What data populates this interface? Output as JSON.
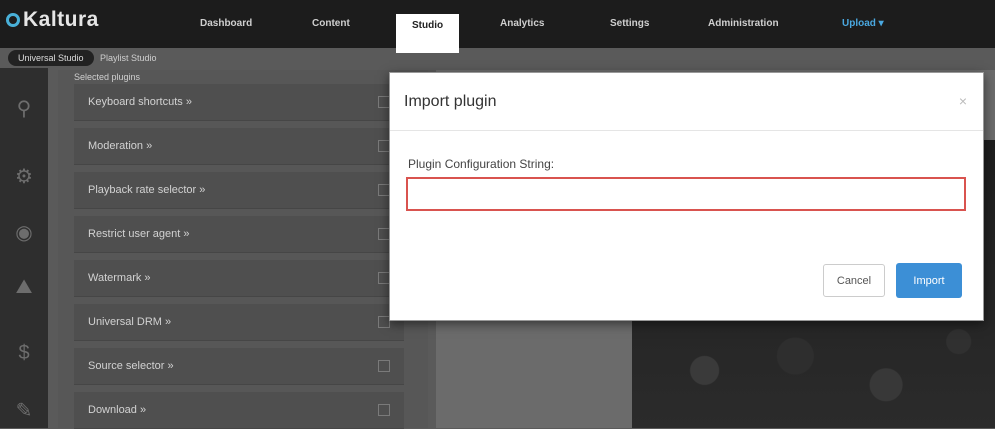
{
  "brand": {
    "name": "Kaltura",
    "accent": "#49b0d8"
  },
  "nav": {
    "items": [
      "Dashboard",
      "Content",
      "Studio",
      "Analytics",
      "Settings",
      "Administration"
    ],
    "active": "Studio",
    "user_menu": "Upload"
  },
  "subtabs": [
    "Universal Studio",
    "Playlist Studio"
  ],
  "panel": {
    "heading": "Selected plugins",
    "plugins": [
      "Keyboard shortcuts »",
      "Moderation »",
      "Playback rate selector »",
      "Restrict user agent »",
      "Watermark »",
      "Universal DRM »",
      "Source selector »",
      "Download »"
    ]
  },
  "modal": {
    "title": "Import plugin",
    "close": "×",
    "field_label": "Plugin Configuration String:",
    "field_value": "",
    "cancel_label": "Cancel",
    "import_label": "Import"
  }
}
